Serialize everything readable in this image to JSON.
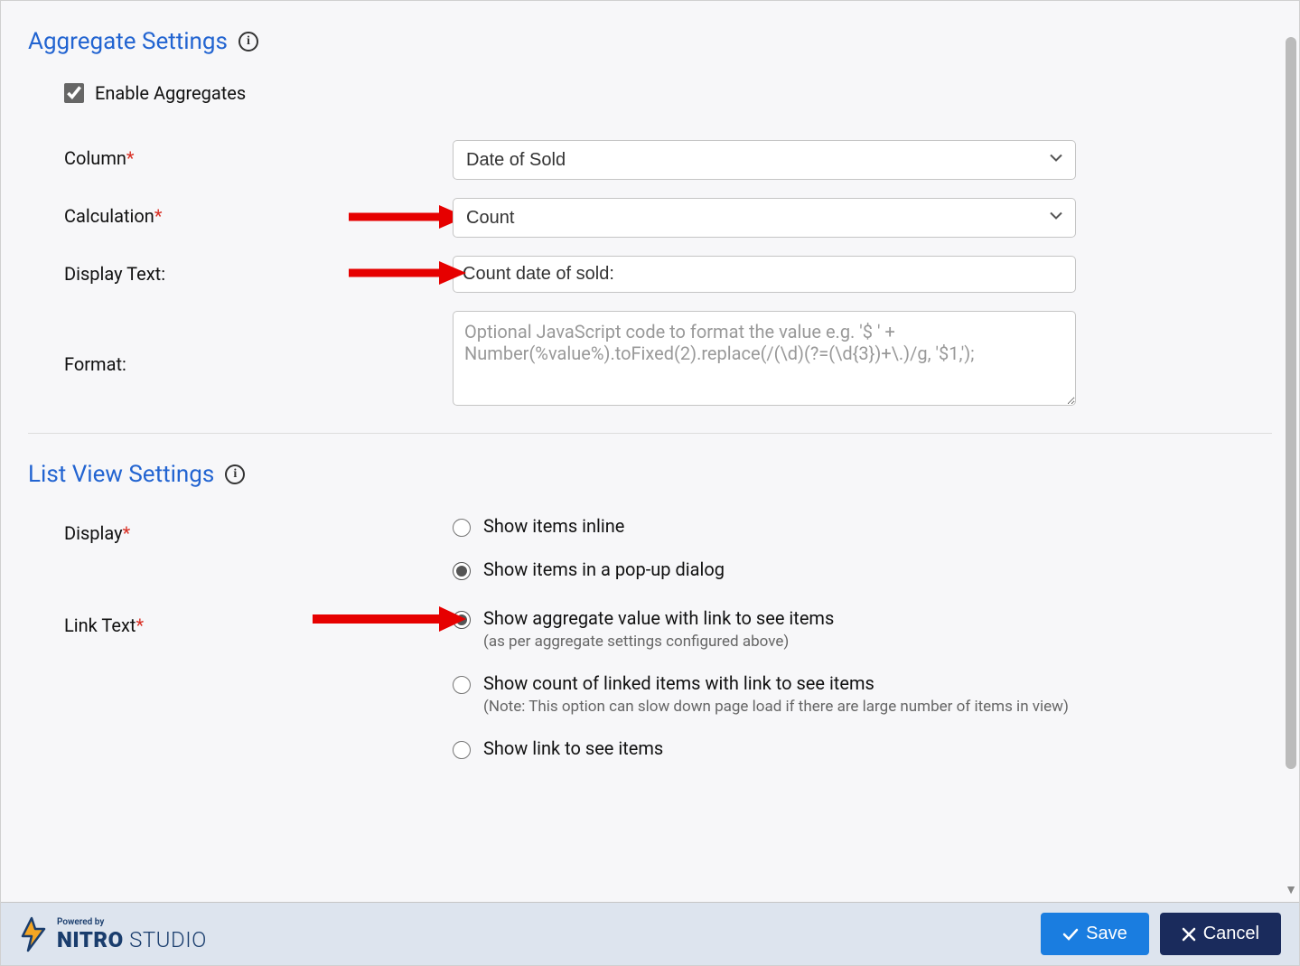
{
  "aggregate": {
    "title": "Aggregate Settings",
    "enable_label": "Enable Aggregates",
    "enable_checked": true,
    "column_label": "Column",
    "column_value": "Date of Sold",
    "calculation_label": "Calculation",
    "calculation_value": "Count",
    "display_text_label": "Display Text:",
    "display_text_value": "Count date of sold:",
    "format_label": "Format:",
    "format_placeholder": "Optional JavaScript code to format the value e.g. '$ ' + Number(%value%).toFixed(2).replace(/(\\d)(?=(\\d{3})+\\.)/g, '$1,');"
  },
  "listview": {
    "title": "List View Settings",
    "display_label": "Display",
    "display_options": [
      {
        "label": "Show items inline",
        "checked": false
      },
      {
        "label": "Show items in a pop-up dialog",
        "checked": true
      }
    ],
    "linktext_label": "Link Text",
    "linktext_options": [
      {
        "label": "Show aggregate value with link to see items",
        "note": "(as per aggregate settings configured above)",
        "checked": true
      },
      {
        "label": "Show count of linked items with link to see items",
        "note": "(Note: This option can slow down page load if there are large number of items in view)",
        "checked": false
      },
      {
        "label": "Show link to see items",
        "note": "",
        "checked": false
      }
    ]
  },
  "footer": {
    "powered_by": "Powered by",
    "brand_bold": "NITRO",
    "brand_light": "STUDIO",
    "save_label": "Save",
    "cancel_label": "Cancel"
  }
}
